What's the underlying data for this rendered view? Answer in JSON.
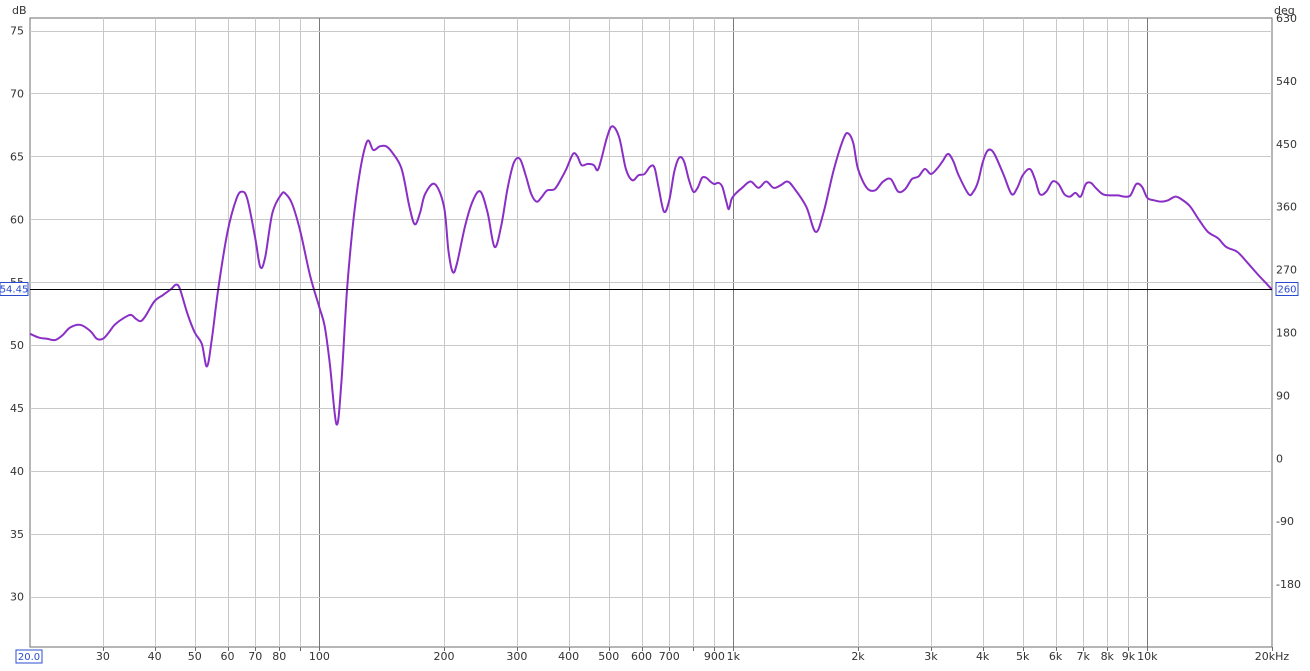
{
  "chart_data": {
    "type": "line",
    "title": "",
    "y_unit_left": "dB",
    "y_unit_right": "deg",
    "x_unit": "kHz",
    "x_scale": "log",
    "xlim": [
      20,
      20000
    ],
    "ylim": [
      26,
      76
    ],
    "right_axis_lim": [
      -270,
      630
    ],
    "grid": true,
    "x_major_ticks": [
      {
        "value": 30,
        "label": "30"
      },
      {
        "value": 40,
        "label": "40"
      },
      {
        "value": 50,
        "label": "50"
      },
      {
        "value": 60,
        "label": "60"
      },
      {
        "value": 70,
        "label": "70"
      },
      {
        "value": 80,
        "label": "80"
      },
      {
        "value": 100,
        "label": "100"
      },
      {
        "value": 200,
        "label": "200"
      },
      {
        "value": 300,
        "label": "300"
      },
      {
        "value": 400,
        "label": "400"
      },
      {
        "value": 500,
        "label": "500"
      },
      {
        "value": 600,
        "label": "600"
      },
      {
        "value": 700,
        "label": "700"
      },
      {
        "value": 900,
        "label": "900"
      },
      {
        "value": 1000,
        "label": "1k"
      },
      {
        "value": 2000,
        "label": "2k"
      },
      {
        "value": 3000,
        "label": "3k"
      },
      {
        "value": 4000,
        "label": "4k"
      },
      {
        "value": 5000,
        "label": "5k"
      },
      {
        "value": 6000,
        "label": "6k"
      },
      {
        "value": 7000,
        "label": "7k"
      },
      {
        "value": 8000,
        "label": "8k"
      },
      {
        "value": 9000,
        "label": "9k"
      },
      {
        "value": 10000,
        "label": "10k"
      },
      {
        "value": 20000,
        "label": "20kHz"
      }
    ],
    "x_minor_ticks": [
      90,
      800,
      8000
    ],
    "x_dark_grid": [
      100,
      1000,
      10000
    ],
    "y_ticks_left": [
      30,
      35,
      40,
      45,
      50,
      55,
      60,
      65,
      70,
      75
    ],
    "y_ticks_right": [
      {
        "value": -180,
        "label": "-180"
      },
      {
        "value": -90,
        "label": "-90"
      },
      {
        "value": 0,
        "label": "0"
      },
      {
        "value": 90,
        "label": "90"
      },
      {
        "value": 180,
        "label": "180"
      },
      {
        "value": 270,
        "label": "270"
      },
      {
        "value": 360,
        "label": "360"
      },
      {
        "value": 450,
        "label": "450"
      },
      {
        "value": 540,
        "label": "540"
      },
      {
        "value": 630,
        "label": "630"
      }
    ],
    "cursor": {
      "left_value": "54.45",
      "right_value": "260",
      "y": 54.45
    },
    "x_start_marker": "20.0",
    "series": [
      {
        "color": "#8a2fc6",
        "points": [
          [
            20,
            50.9
          ],
          [
            21,
            50.6
          ],
          [
            22,
            50.5
          ],
          [
            23,
            50.4
          ],
          [
            24,
            50.8
          ],
          [
            25,
            51.4
          ],
          [
            26.5,
            51.6
          ],
          [
            28,
            51.1
          ],
          [
            29,
            50.5
          ],
          [
            30,
            50.5
          ],
          [
            31,
            51.0
          ],
          [
            32,
            51.6
          ],
          [
            33.5,
            52.1
          ],
          [
            35,
            52.4
          ],
          [
            36,
            52.1
          ],
          [
            37,
            51.9
          ],
          [
            38,
            52.3
          ],
          [
            40,
            53.5
          ],
          [
            42,
            54.0
          ],
          [
            44,
            54.5
          ],
          [
            45,
            54.8
          ],
          [
            46,
            54.5
          ],
          [
            48,
            52.5
          ],
          [
            50,
            51.0
          ],
          [
            52,
            50.1
          ],
          [
            53.5,
            48.3
          ],
          [
            55,
            50.5
          ],
          [
            57,
            54.5
          ],
          [
            60,
            59.0
          ],
          [
            63,
            61.6
          ],
          [
            65,
            62.2
          ],
          [
            67,
            61.6
          ],
          [
            70,
            58.5
          ],
          [
            72,
            56.2
          ],
          [
            74,
            57.0
          ],
          [
            77,
            60.5
          ],
          [
            81,
            62.0
          ],
          [
            83,
            62.0
          ],
          [
            86,
            61.2
          ],
          [
            90,
            59.0
          ],
          [
            95,
            55.5
          ],
          [
            100,
            53.0
          ],
          [
            103,
            51.5
          ],
          [
            106,
            48.5
          ],
          [
            110,
            43.7
          ],
          [
            113,
            47.0
          ],
          [
            117,
            55.0
          ],
          [
            123,
            62.0
          ],
          [
            130,
            66.1
          ],
          [
            135,
            65.5
          ],
          [
            140,
            65.8
          ],
          [
            145,
            65.8
          ],
          [
            150,
            65.3
          ],
          [
            158,
            64.0
          ],
          [
            165,
            61.0
          ],
          [
            170,
            59.6
          ],
          [
            175,
            60.5
          ],
          [
            180,
            62.0
          ],
          [
            190,
            62.8
          ],
          [
            200,
            61.0
          ],
          [
            205,
            57.5
          ],
          [
            210,
            55.8
          ],
          [
            215,
            56.5
          ],
          [
            225,
            59.5
          ],
          [
            235,
            61.5
          ],
          [
            245,
            62.2
          ],
          [
            255,
            60.5
          ],
          [
            265,
            57.8
          ],
          [
            275,
            59.5
          ],
          [
            285,
            62.5
          ],
          [
            295,
            64.5
          ],
          [
            305,
            64.8
          ],
          [
            315,
            63.5
          ],
          [
            325,
            62.0
          ],
          [
            335,
            61.4
          ],
          [
            345,
            61.8
          ],
          [
            355,
            62.3
          ],
          [
            370,
            62.4
          ],
          [
            385,
            63.3
          ],
          [
            395,
            64.0
          ],
          [
            410,
            65.2
          ],
          [
            420,
            65.0
          ],
          [
            430,
            64.3
          ],
          [
            445,
            64.4
          ],
          [
            460,
            64.3
          ],
          [
            470,
            63.9
          ],
          [
            480,
            64.8
          ],
          [
            495,
            66.5
          ],
          [
            510,
            67.4
          ],
          [
            530,
            66.5
          ],
          [
            550,
            64.0
          ],
          [
            570,
            63.1
          ],
          [
            590,
            63.5
          ],
          [
            610,
            63.6
          ],
          [
            630,
            64.2
          ],
          [
            645,
            64.1
          ],
          [
            660,
            62.5
          ],
          [
            680,
            60.6
          ],
          [
            700,
            61.5
          ],
          [
            720,
            63.8
          ],
          [
            740,
            64.9
          ],
          [
            760,
            64.6
          ],
          [
            780,
            63.2
          ],
          [
            800,
            62.2
          ],
          [
            820,
            62.5
          ],
          [
            840,
            63.3
          ],
          [
            860,
            63.3
          ],
          [
            880,
            63.0
          ],
          [
            900,
            62.8
          ],
          [
            920,
            62.9
          ],
          [
            940,
            62.6
          ],
          [
            960,
            61.5
          ],
          [
            975,
            60.8
          ],
          [
            990,
            61.6
          ],
          [
            1010,
            62.0
          ],
          [
            1050,
            62.5
          ],
          [
            1100,
            63.0
          ],
          [
            1150,
            62.5
          ],
          [
            1200,
            63.0
          ],
          [
            1250,
            62.5
          ],
          [
            1300,
            62.7
          ],
          [
            1350,
            63.0
          ],
          [
            1400,
            62.5
          ],
          [
            1500,
            61.0
          ],
          [
            1580,
            59.0
          ],
          [
            1650,
            60.5
          ],
          [
            1750,
            64.0
          ],
          [
            1850,
            66.5
          ],
          [
            1900,
            66.8
          ],
          [
            1950,
            66.0
          ],
          [
            2000,
            64.0
          ],
          [
            2100,
            62.5
          ],
          [
            2200,
            62.3
          ],
          [
            2300,
            63.0
          ],
          [
            2400,
            63.2
          ],
          [
            2500,
            62.2
          ],
          [
            2600,
            62.4
          ],
          [
            2700,
            63.2
          ],
          [
            2800,
            63.4
          ],
          [
            2900,
            64.0
          ],
          [
            3000,
            63.6
          ],
          [
            3100,
            64.0
          ],
          [
            3200,
            64.6
          ],
          [
            3300,
            65.2
          ],
          [
            3400,
            64.6
          ],
          [
            3500,
            63.5
          ],
          [
            3700,
            62.0
          ],
          [
            3800,
            62.2
          ],
          [
            3900,
            63.0
          ],
          [
            4000,
            64.5
          ],
          [
            4100,
            65.4
          ],
          [
            4200,
            65.5
          ],
          [
            4300,
            65.0
          ],
          [
            4500,
            63.5
          ],
          [
            4700,
            62.0
          ],
          [
            4850,
            62.5
          ],
          [
            5000,
            63.5
          ],
          [
            5200,
            64.0
          ],
          [
            5350,
            63.2
          ],
          [
            5500,
            62.0
          ],
          [
            5700,
            62.2
          ],
          [
            5900,
            63.0
          ],
          [
            6100,
            62.8
          ],
          [
            6300,
            62.0
          ],
          [
            6500,
            61.8
          ],
          [
            6700,
            62.1
          ],
          [
            6900,
            61.8
          ],
          [
            7100,
            62.8
          ],
          [
            7300,
            62.9
          ],
          [
            7500,
            62.5
          ],
          [
            7800,
            62.0
          ],
          [
            8100,
            61.9
          ],
          [
            8500,
            61.9
          ],
          [
            8800,
            61.8
          ],
          [
            9100,
            61.9
          ],
          [
            9400,
            62.8
          ],
          [
            9700,
            62.6
          ],
          [
            10000,
            61.7
          ],
          [
            10400,
            61.5
          ],
          [
            10800,
            61.4
          ],
          [
            11200,
            61.5
          ],
          [
            11700,
            61.8
          ],
          [
            12200,
            61.5
          ],
          [
            12700,
            61.0
          ],
          [
            13300,
            60.0
          ],
          [
            14000,
            59.0
          ],
          [
            14800,
            58.5
          ],
          [
            15500,
            57.8
          ],
          [
            16500,
            57.4
          ],
          [
            17500,
            56.5
          ],
          [
            18500,
            55.6
          ],
          [
            19500,
            54.8
          ],
          [
            20000,
            54.4
          ]
        ]
      }
    ]
  }
}
